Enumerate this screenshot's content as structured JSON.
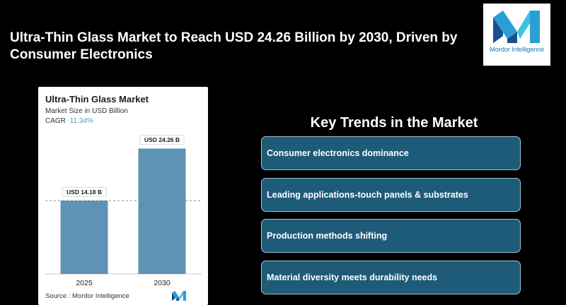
{
  "headline": "Ultra-Thin Glass Market to Reach USD 24.26 Billion by 2030, Driven by Consumer Electronics",
  "logo": {
    "text": "Mordor Intelligence"
  },
  "chart_data": {
    "type": "bar",
    "title": "Ultra-Thin Glass Market",
    "subtitle": "Market Size in USD Billion",
    "cagr_label": "CAGR",
    "cagr_value": "11.34%",
    "categories": [
      "2025",
      "2030"
    ],
    "values": [
      14.18,
      24.26
    ],
    "data_labels": [
      "USD 14.18 B",
      "USD 24.26 B"
    ],
    "ylim": [
      0,
      28
    ],
    "bar_color": "#5f93b6",
    "source": "Source : Mordor Intelligence"
  },
  "trends": {
    "title": "Key Trends in the Market",
    "items": [
      "Consumer electronics dominance",
      "Leading applications-touch panels & substrates",
      "Production methods shifting",
      "Material diversity meets durability needs"
    ]
  }
}
